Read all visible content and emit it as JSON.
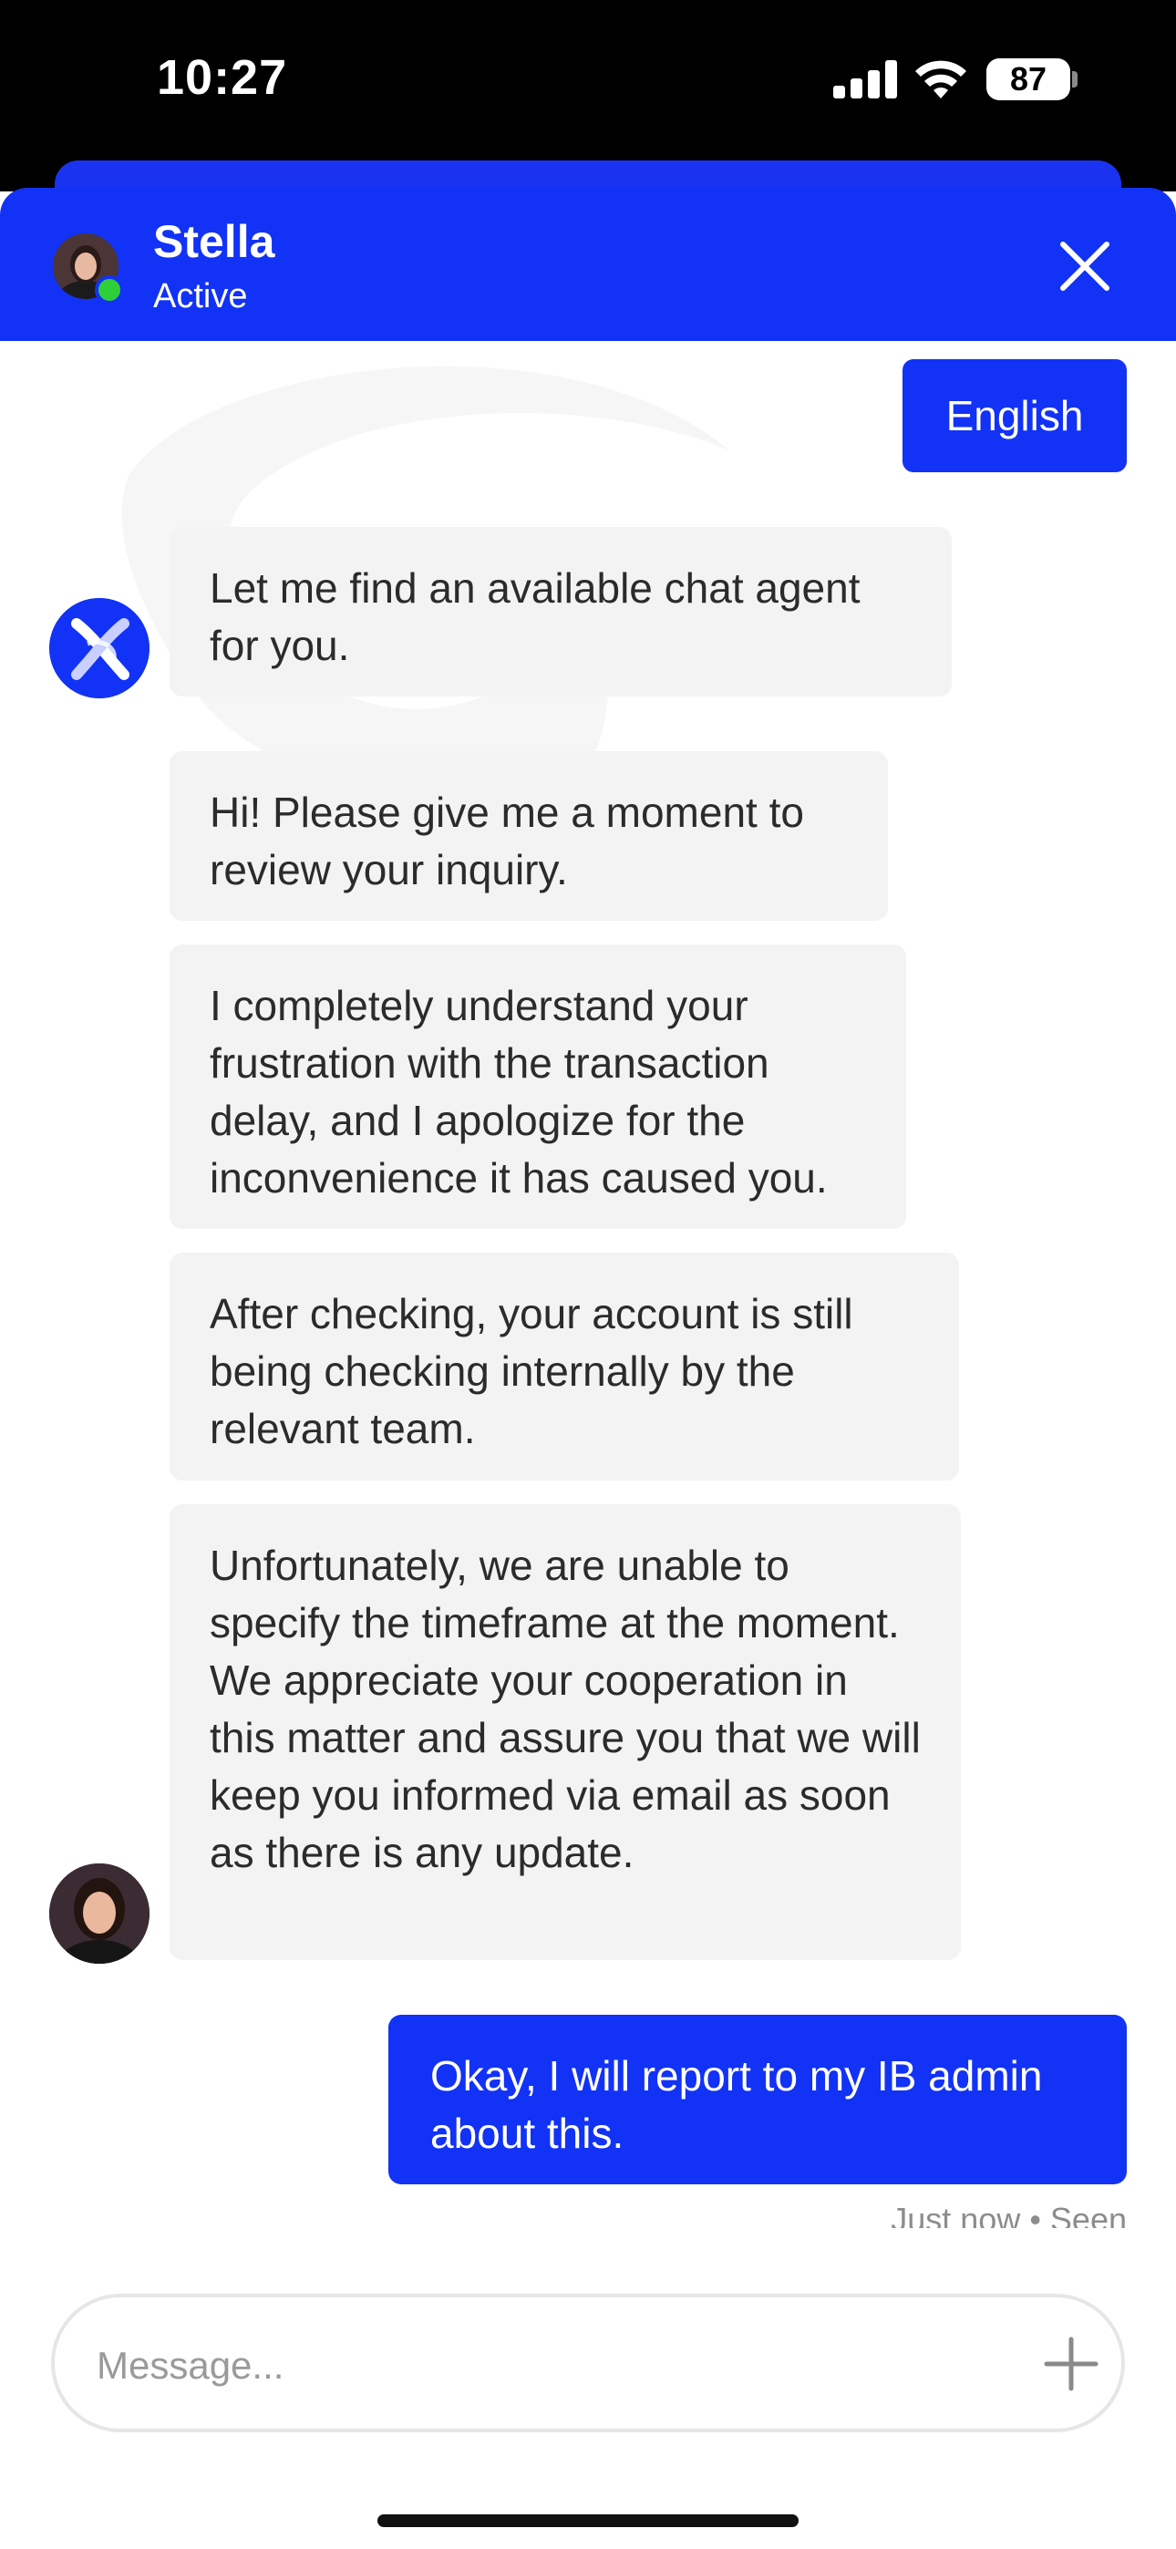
{
  "status_bar": {
    "time": "10:27",
    "battery": "87"
  },
  "header": {
    "agent_name": "Stella",
    "agent_status": "Active"
  },
  "language_button": "English",
  "messages": [
    {
      "sender": "bot",
      "text": "Let me find an available chat agent for you."
    },
    {
      "sender": "agent",
      "text": "Hi! Please give me a moment to review your inquiry."
    },
    {
      "sender": "agent",
      "text": "I completely understand your frustration with the transaction delay, and I apologize for the inconvenience it has caused you."
    },
    {
      "sender": "agent",
      "text": "After checking, your account is still being checking internally by the relevant team."
    },
    {
      "sender": "agent",
      "text": "Unfortunately, we are unable to specify the timeframe at the moment. We appreciate your cooperation in this matter and assure you that we will keep you informed via email as soon as there is any update."
    },
    {
      "sender": "user",
      "text": "Okay, I will report to my IB admin about this."
    }
  ],
  "receipt": "Just now • Seen",
  "composer": {
    "placeholder": "Message...",
    "value": ""
  },
  "colors": {
    "brand": "#1232f5",
    "bubble": "#f3f3f3",
    "online": "#2fcf3a"
  },
  "icons": [
    "signal-icon",
    "wifi-icon",
    "battery-icon",
    "close-icon",
    "plus-icon",
    "bot-logo-icon"
  ]
}
